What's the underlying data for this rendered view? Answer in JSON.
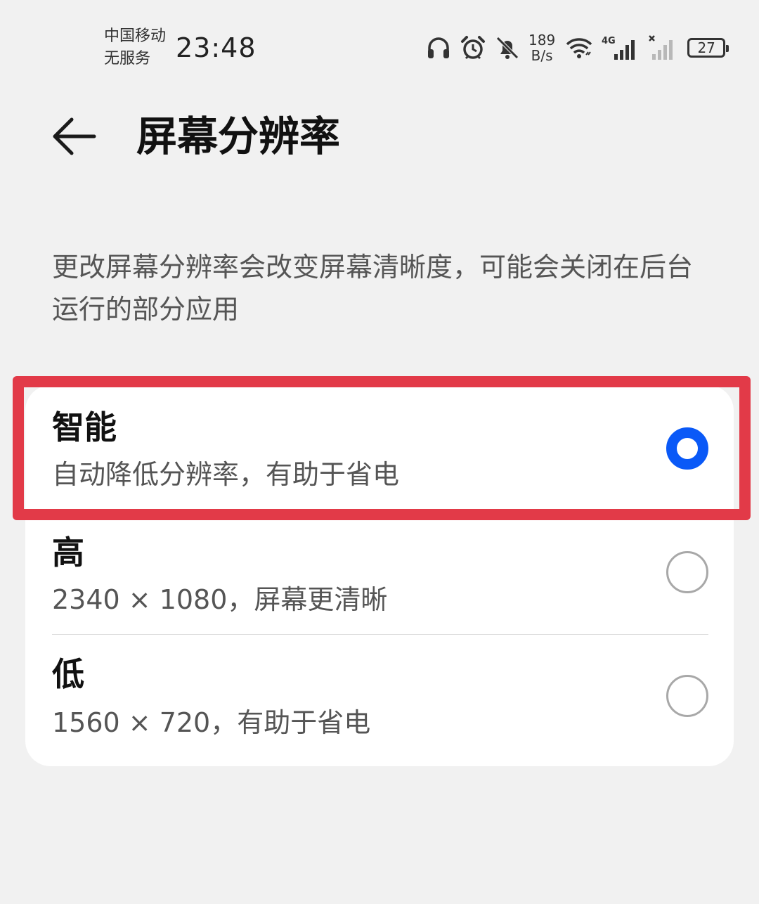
{
  "status_bar": {
    "carrier_line1": "中国移动",
    "carrier_line2": "无服务",
    "time": "23:48",
    "net_speed_value": "189",
    "net_speed_unit": "B/s",
    "network_type": "4G",
    "battery_level": "27",
    "icons": [
      "headphones-icon",
      "alarm-icon",
      "bell-muted-icon",
      "wifi-icon",
      "signal-4g-icon",
      "signal-no-service-icon",
      "battery-icon"
    ]
  },
  "header": {
    "title": "屏幕分辨率",
    "back_icon": "back-arrow-icon"
  },
  "description": "更改屏幕分辨率会改变屏幕清晰度，可能会关闭在后台运行的部分应用",
  "options": [
    {
      "title": "智能",
      "subtitle": "自动降低分辨率，有助于省电",
      "selected": true
    },
    {
      "title": "高",
      "subtitle": "2340 × 1080，屏幕更清晰",
      "selected": false
    },
    {
      "title": "低",
      "subtitle": "1560 × 720，有助于省电",
      "selected": false
    }
  ],
  "colors": {
    "accent": "#0a59f7",
    "highlight": "#e23a48",
    "background": "#f1f1f1",
    "card": "#ffffff"
  }
}
